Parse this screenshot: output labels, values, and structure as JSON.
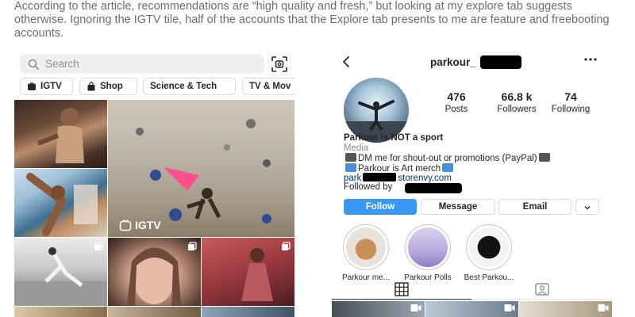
{
  "article": {
    "text": "According to the article, recommendations are “high quality and fresh,” but looking at my explore tab suggests otherwise. Ignoring the IGTV tile, half of the accounts that the Explore tab presents to me are feature and freebooting accounts."
  },
  "explore": {
    "search_placeholder": "Search",
    "chips": {
      "igtv": "IGTV",
      "shop": "Shop",
      "science_tech": "Science & Tech",
      "tv_movies": "TV & Mov"
    },
    "igtv_badge": "IGTV"
  },
  "profile": {
    "username": "parkour_",
    "stats": {
      "posts_value": "476",
      "posts_label": "Posts",
      "followers_value": "66.8 k",
      "followers_label": "Followers",
      "following_value": "74",
      "following_label": "Following"
    },
    "bio": {
      "name": "Parkour is NOT a sport",
      "category": "Media",
      "line1": "DM me for shout-out or promotions (PayPal)",
      "line2": "Parkour is Art merch",
      "link_prefix": "park",
      "link_suffix": "storenvy.com",
      "followed_by": "Followed by"
    },
    "buttons": {
      "follow": "Follow",
      "message": "Message",
      "email": "Email"
    },
    "highlights": [
      {
        "label": "Parkour me..."
      },
      {
        "label": "Parkour Polls"
      },
      {
        "label": "Best Parkou..."
      }
    ]
  },
  "colors": {
    "follow_button": "#3897f0",
    "link": "#00376b",
    "article_text": "#6e6e6e"
  }
}
